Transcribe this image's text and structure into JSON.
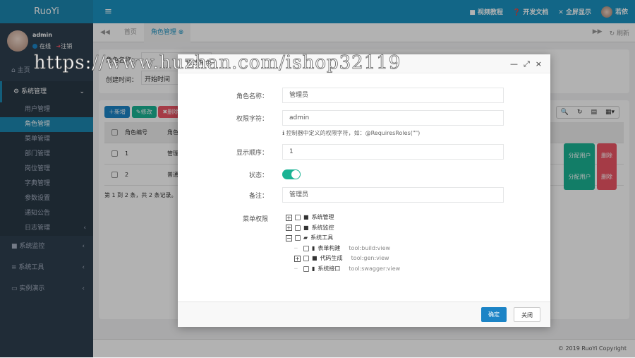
{
  "app": {
    "logo": "RuoYi"
  },
  "user": {
    "name": "admin",
    "status": "在线",
    "logout": "注销"
  },
  "sidebar": {
    "home": "主页",
    "groups": [
      {
        "label": "系统管理",
        "open": true,
        "items": [
          "用户管理",
          "角色管理",
          "菜单管理",
          "部门管理",
          "岗位管理",
          "字典管理",
          "参数设置",
          "通知公告",
          "日志管理"
        ],
        "active": "角色管理"
      },
      {
        "label": "系统监控"
      },
      {
        "label": "系统工具"
      },
      {
        "label": "实例演示"
      }
    ]
  },
  "header": {
    "links": [
      "视频教程",
      "开发文档",
      "全屏显示"
    ],
    "user": "若依"
  },
  "tabs": {
    "items": [
      "首页",
      "角色管理"
    ],
    "active": "角色管理",
    "refresh": "刷新"
  },
  "search": {
    "role_name_label": "角色名称：",
    "create_time_label": "创建时间：",
    "start_placeholder": "开始时间"
  },
  "toolbar": {
    "add": "新增",
    "edit": "修改",
    "delete": "删除"
  },
  "table": {
    "headers": [
      "角色编号",
      "角色名称"
    ],
    "rows": [
      {
        "id": "1",
        "name": "管理员"
      },
      {
        "id": "2",
        "name": "普通角色"
      }
    ],
    "assign_user": "分配用户",
    "delete": "删除",
    "pagination": "第 1 到 2 条，共 2 条记录。"
  },
  "modal": {
    "title": "修改角色",
    "role_name_label": "角色名称：",
    "role_name": "管理员",
    "perm_label": "权限字符：",
    "perm": "admin",
    "perm_hint": "控制器中定义的权限字符，如：@RequiresRoles(\"\")",
    "order_label": "显示顺序：",
    "order": "1",
    "status_label": "状态：",
    "status_on": true,
    "remark_label": "备注：",
    "remark": "管理员",
    "menu_label": "菜单权限",
    "tree": [
      {
        "label": "系统管理",
        "perm": "",
        "level": 0,
        "switch": "+",
        "icon": "folder"
      },
      {
        "label": "系统监控",
        "perm": "",
        "level": 0,
        "switch": "+",
        "icon": "folder"
      },
      {
        "label": "系统工具",
        "perm": "",
        "level": 0,
        "switch": "-",
        "icon": "folder-open"
      },
      {
        "label": "表单构建",
        "perm": "tool:build:view",
        "level": 1,
        "switch": "",
        "icon": "file"
      },
      {
        "label": "代码生成",
        "perm": "tool:gen:view",
        "level": 1,
        "switch": "+",
        "icon": "folder"
      },
      {
        "label": "系统接口",
        "perm": "tool:swagger:view",
        "level": 1,
        "switch": "",
        "icon": "file"
      }
    ],
    "confirm": "确定",
    "close": "关闭"
  },
  "footer": {
    "copyright": "© 2019 RuoYi Copyright"
  },
  "watermark": "https://www.huzhan.com/ishop32119",
  "colors": {
    "sidebar": "#2f4050",
    "header": "#1a93c2",
    "primary": "#1c84c6",
    "success": "#1ab394",
    "danger": "#ed5565"
  }
}
